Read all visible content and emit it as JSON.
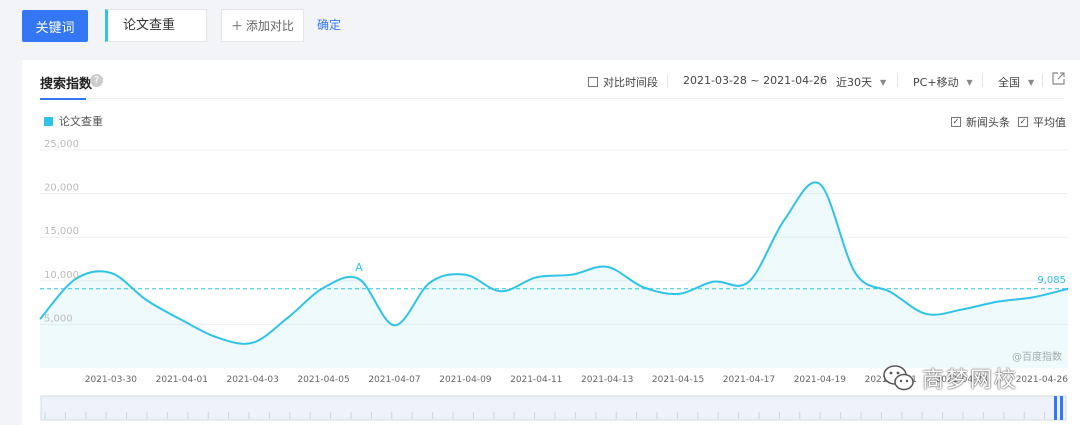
{
  "toolbar": {
    "keyword_button": "关键词",
    "keyword_value": "论文查重",
    "add_compare": "添加对比",
    "confirm": "确定"
  },
  "panel": {
    "tab_title": "搜索指数",
    "help": "?",
    "compare_period": "对比时间段",
    "date_range": "2021-03-28 ~ 2021-04-26",
    "period": "近30天",
    "device": "PC+移动",
    "region": "全国",
    "opt_news": "新闻头条",
    "opt_avg": "平均值",
    "watermark": "@百度指数",
    "brand": "商梦网校"
  },
  "chart_data": {
    "type": "area",
    "x": [
      "2021-03-28",
      "2021-03-29",
      "2021-03-30",
      "2021-03-31",
      "2021-04-01",
      "2021-04-02",
      "2021-04-03",
      "2021-04-04",
      "2021-04-05",
      "2021-04-06",
      "2021-04-07",
      "2021-04-08",
      "2021-04-09",
      "2021-04-10",
      "2021-04-11",
      "2021-04-12",
      "2021-04-13",
      "2021-04-14",
      "2021-04-15",
      "2021-04-16",
      "2021-04-17",
      "2021-04-18",
      "2021-04-19",
      "2021-04-20",
      "2021-04-21",
      "2021-04-22",
      "2021-04-23",
      "2021-04-24",
      "2021-04-25",
      "2021-04-26"
    ],
    "tick_labels": [
      "2021-03-30",
      "2021-04-01",
      "2021-04-03",
      "2021-04-05",
      "2021-04-07",
      "2021-04-09",
      "2021-04-11",
      "2021-04-13",
      "2021-04-15",
      "2021-04-17",
      "2021-04-19",
      "2021-04-21",
      "2021-04-23",
      "2021-04-26"
    ],
    "series": [
      {
        "name": "论文查重",
        "color": "#2fc3e8",
        "values": [
          5600,
          10200,
          10900,
          7800,
          5500,
          3500,
          2900,
          5800,
          9200,
          10200,
          4900,
          9800,
          10700,
          8800,
          10400,
          10700,
          11600,
          9300,
          8500,
          9900,
          9900,
          17000,
          21100,
          10900,
          8700,
          6200,
          6700,
          7600,
          8100,
          9085
        ]
      }
    ],
    "average": 9085,
    "average_label": "9,085",
    "annotation": {
      "label": "A",
      "x": "2021-04-06",
      "y": 10200
    },
    "yticks": [
      5000,
      10000,
      15000,
      20000,
      25000
    ],
    "ytick_labels": [
      "5,000",
      "10,000",
      "15,000",
      "20,000",
      "25,000"
    ],
    "ylim": [
      0,
      25000
    ],
    "grid": true,
    "legend": "top-left"
  }
}
